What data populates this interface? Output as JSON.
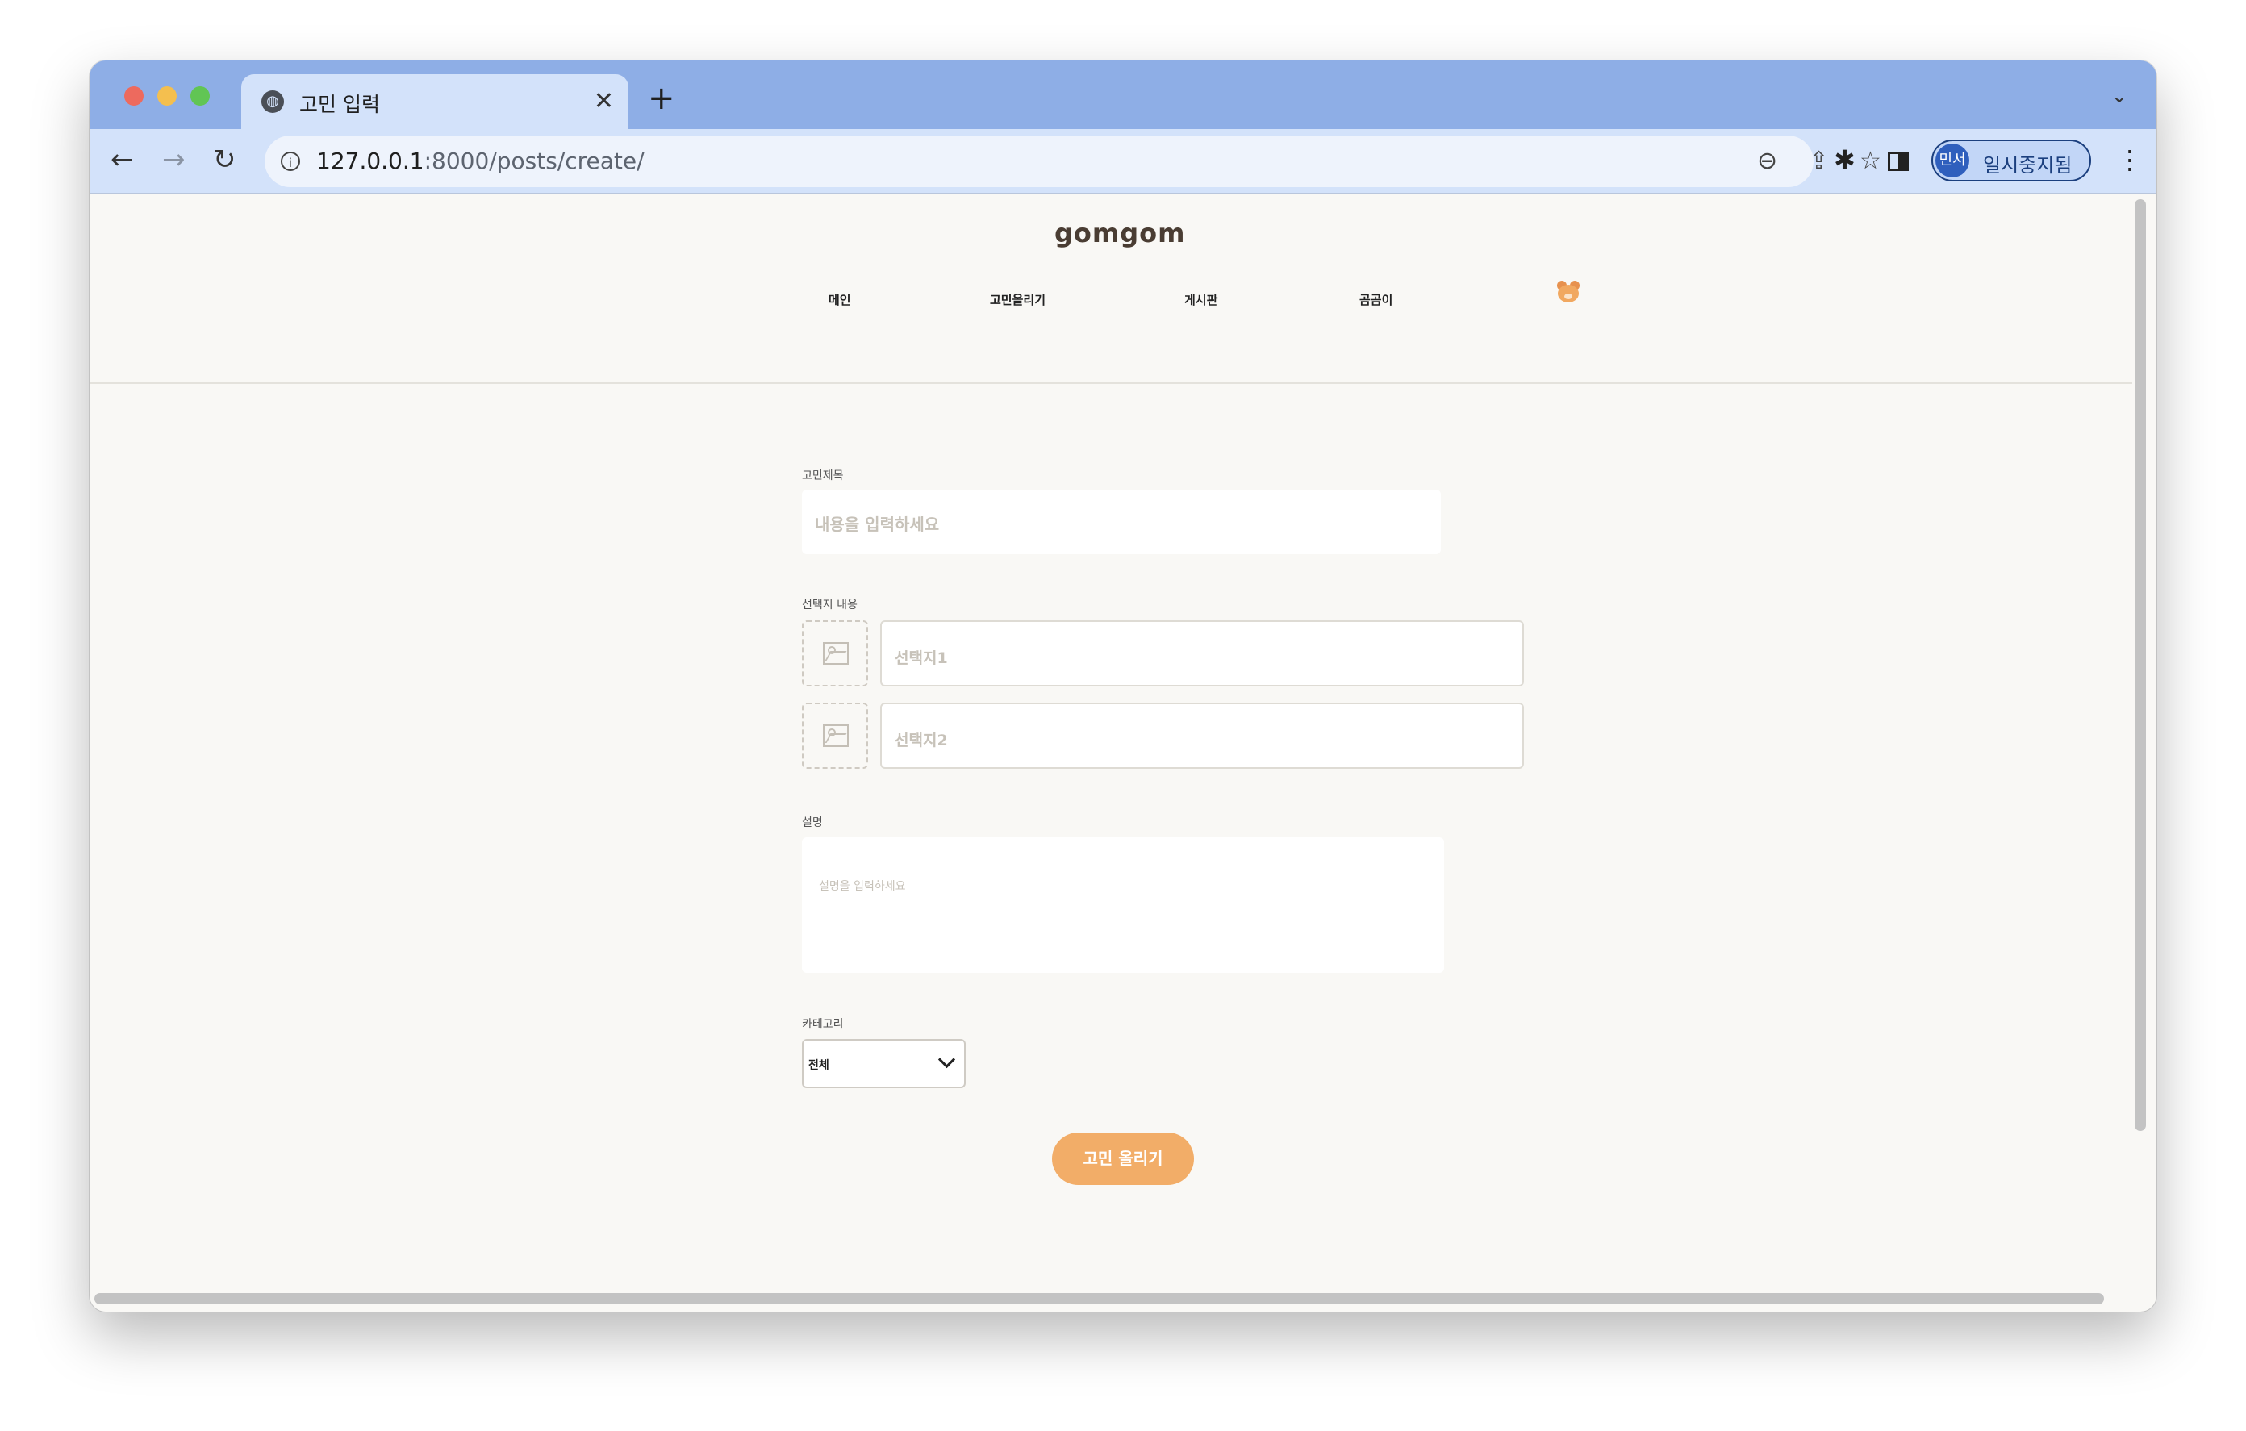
{
  "browser": {
    "tab_title": "고민 입력",
    "new_tab_symbol": "+",
    "url_host": "127.0.0.1",
    "url_rest": ":8000/posts/create/",
    "profile_initials": "민서",
    "profile_status": "일시중지됨"
  },
  "site": {
    "brand": "gomgom",
    "nav": [
      "메인",
      "고민올리기",
      "게시판",
      "곰곰이"
    ]
  },
  "form": {
    "title_label": "고민제목",
    "title_placeholder": "내용을 입력하세요",
    "choices_label": "선택지 내용",
    "choice1_placeholder": "선택지1",
    "choice2_placeholder": "선택지2",
    "desc_label": "설명",
    "desc_placeholder": "설명을 입력하세요",
    "category_label": "카테고리",
    "category_value": "전체",
    "submit_label": "고민 올리기"
  },
  "colors": {
    "accent": "#f2ad68",
    "page_bg": "#f9f8f5",
    "tabbar_bg": "#8eaee6"
  }
}
